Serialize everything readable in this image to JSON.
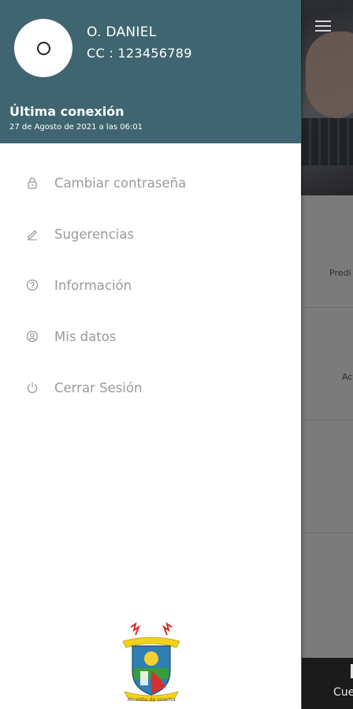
{
  "drawer": {
    "user_name": "O. DANIEL",
    "user_id": "CC : 123456789",
    "last_connection_title": "Última conexión",
    "last_connection_date": "27 de Agosto de 2021 a las 06:01",
    "menu_items": [
      {
        "label": "Cambiar contraseña",
        "icon": "lock-icon"
      },
      {
        "label": "Sugerencias",
        "icon": "pencil-icon"
      },
      {
        "label": "Información",
        "icon": "question-circle-icon"
      },
      {
        "label": "Mis datos",
        "icon": "user-circle-icon"
      },
      {
        "label": "Cerrar Sesión",
        "icon": "power-icon"
      }
    ],
    "logo_caption": "Alcaldía de soacha"
  },
  "background": {
    "card_texts": [
      "Predi",
      "Ac"
    ],
    "bottom_tab_label": "Cue"
  },
  "colors": {
    "header": "#3f6670",
    "menu_text": "#9a9a9a",
    "overlay": "#7a7a7a"
  }
}
